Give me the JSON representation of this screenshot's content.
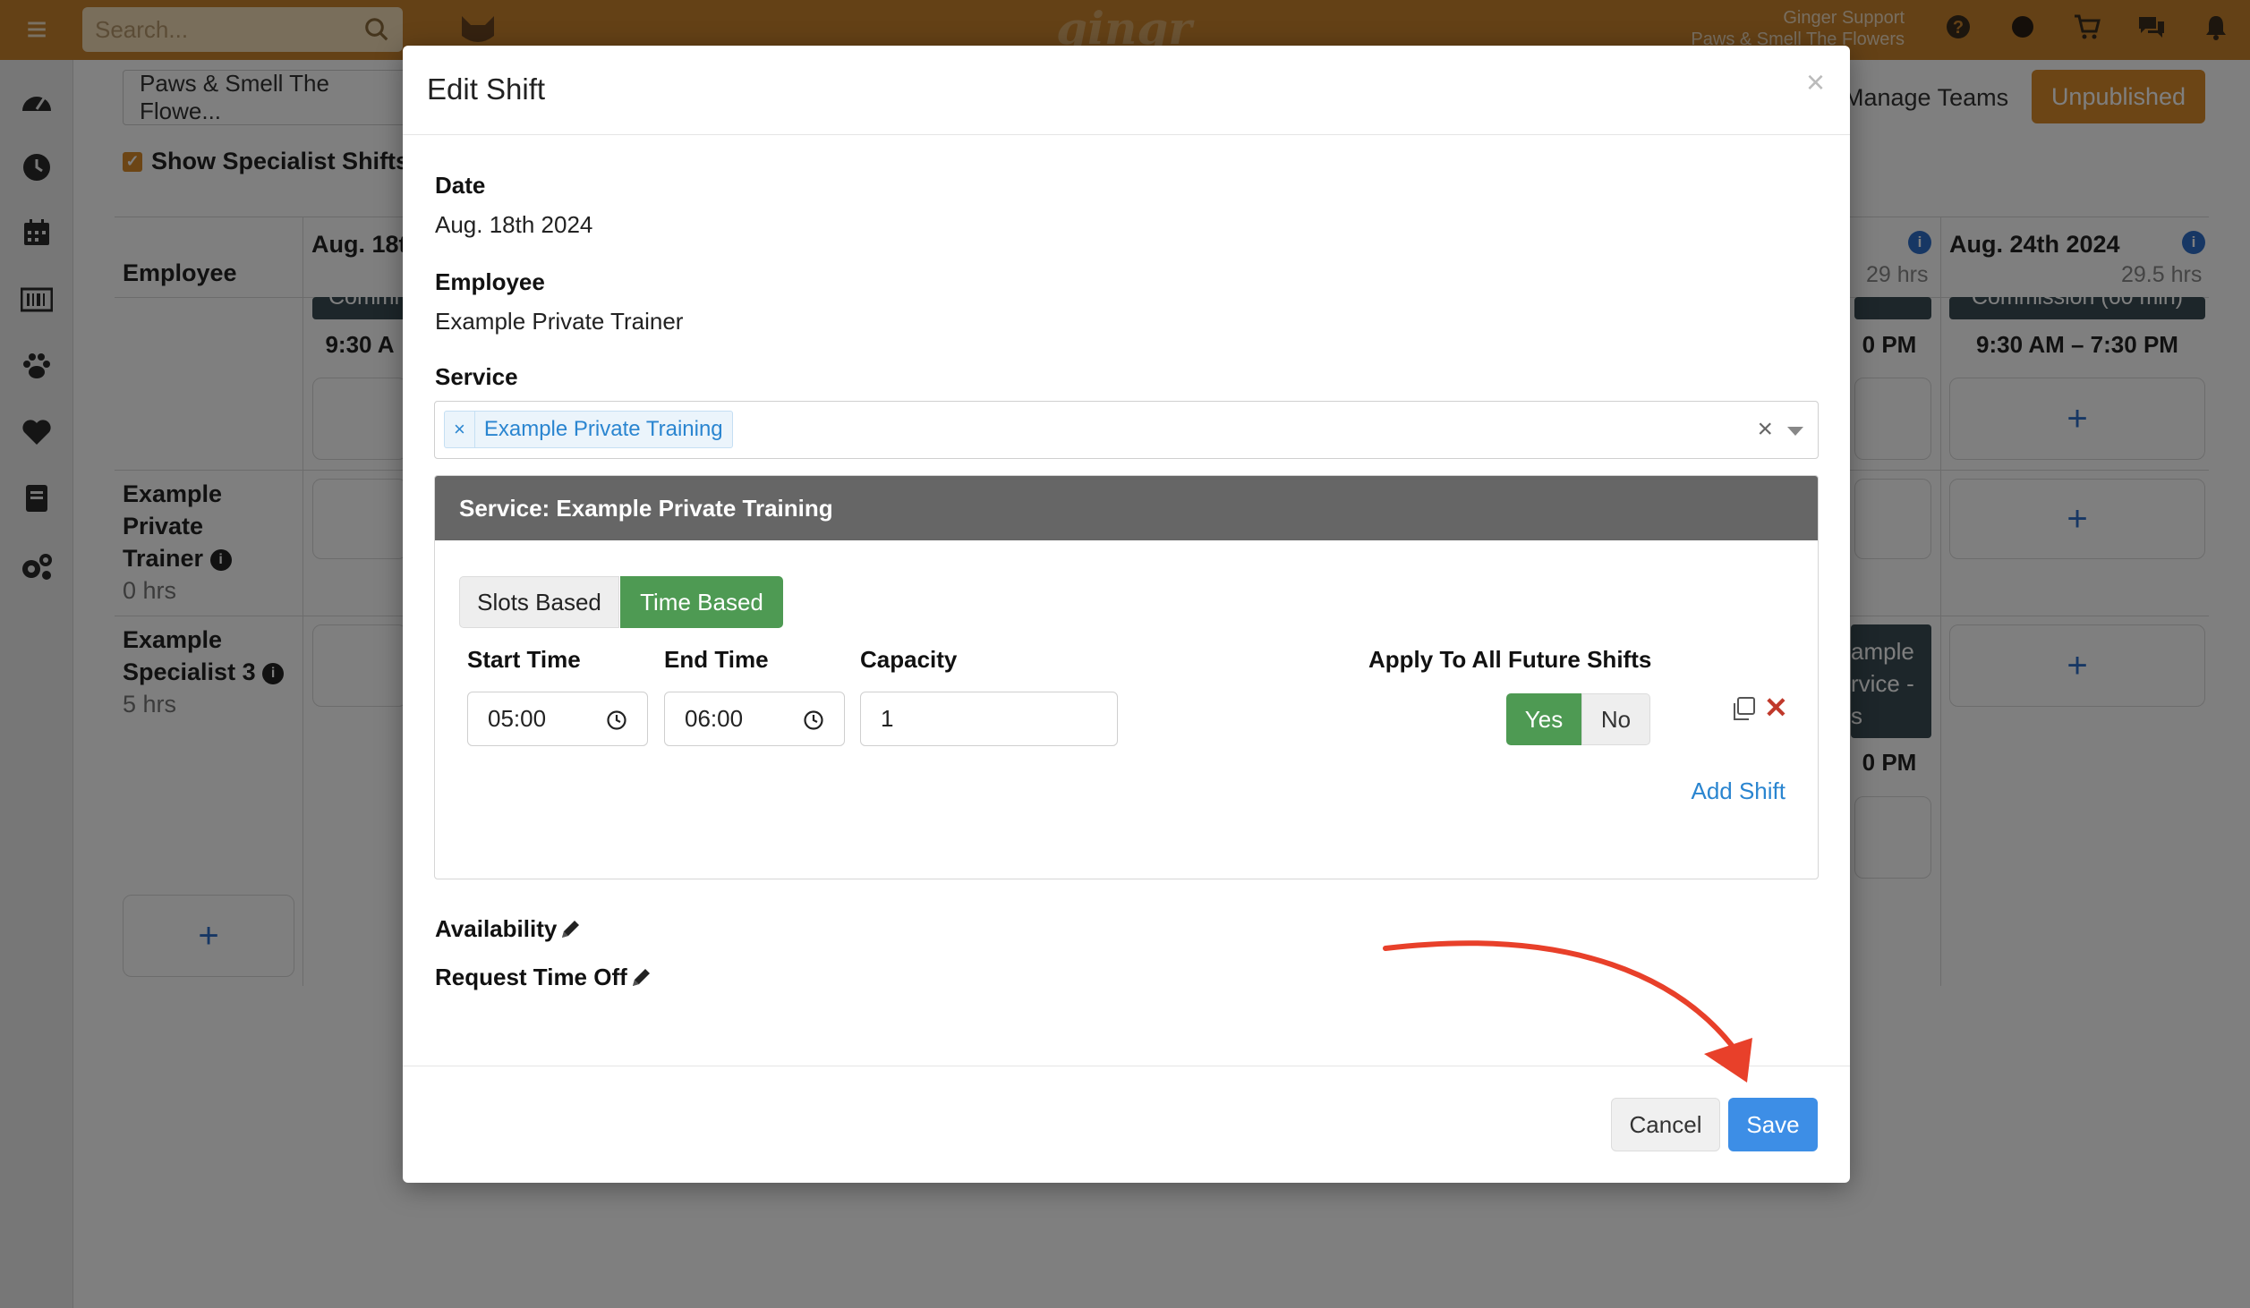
{
  "app": {
    "search_placeholder": "Search...",
    "brand": "gingr",
    "support_name": "Ginger Support",
    "support_location": "Paws & Smell The Flowers",
    "location_select": "Paws & Smell The Flowe...",
    "show_specialist_label": "Show Specialist Shifts",
    "manage_teams": "Manage Teams",
    "unpublished": "Unpublished",
    "employee_header": "Employee",
    "employees": [
      {
        "name": "Example Private Trainer",
        "name_lines": [
          "Example",
          "Private",
          "Trainer"
        ],
        "hours": "0 hrs"
      },
      {
        "name": "Example Specialist 3",
        "name_lines": [
          "Example",
          "Specialist 3"
        ],
        "hours": "5 hrs"
      }
    ],
    "days": [
      {
        "label": "Aug. 18t",
        "hours": ""
      },
      {
        "label": "",
        "hours": "29 hrs"
      },
      {
        "label": "Aug. 24th 2024",
        "hours": "29.5 hrs"
      }
    ],
    "shift_times": [
      "9:30 A",
      "0 PM",
      "9:30 AM – 7:30 PM",
      "0 PM"
    ],
    "shift_card_texts": [
      "Commi",
      "Commission (60 min)",
      "ample",
      "rvice -",
      "s"
    ]
  },
  "modal": {
    "title": "Edit Shift",
    "date_label": "Date",
    "date_value": "Aug. 18th 2024",
    "employee_label": "Employee",
    "employee_value": "Example Private Trainer",
    "service_label": "Service",
    "selected_service": "Example Private Training",
    "service_panel_title": "Service: Example Private Training",
    "mode_slots": "Slots Based",
    "mode_time": "Time Based",
    "active_mode": "Time Based",
    "start_time_label": "Start Time",
    "end_time_label": "End Time",
    "capacity_label": "Capacity",
    "apply_label": "Apply To All Future Shifts",
    "start_time": "05:00",
    "end_time": "06:00",
    "capacity": "1",
    "yes": "Yes",
    "no": "No",
    "apply_selected": "Yes",
    "add_shift": "Add Shift",
    "availability": "Availability",
    "request_time_off": "Request Time Off",
    "cancel": "Cancel",
    "save": "Save"
  },
  "colors": {
    "topbar": "#c8822c",
    "accent_orange": "#d98b2b",
    "success_green": "#4e9a53",
    "primary_blue": "#3d8ee6",
    "annotation_arrow": "#e8402a"
  },
  "icons": [
    "menu-icon",
    "search-icon",
    "dog-logo-icon",
    "help-icon",
    "status-dot-icon",
    "cart-icon",
    "chat-icon",
    "bell-icon",
    "dashboard-icon",
    "clock-icon",
    "calendar-icon",
    "barcode-icon",
    "paw-icon",
    "heart-icon",
    "book-icon",
    "settings-icon",
    "copy-icon",
    "remove-icon",
    "pencil-icon",
    "clock-input-icon"
  ]
}
